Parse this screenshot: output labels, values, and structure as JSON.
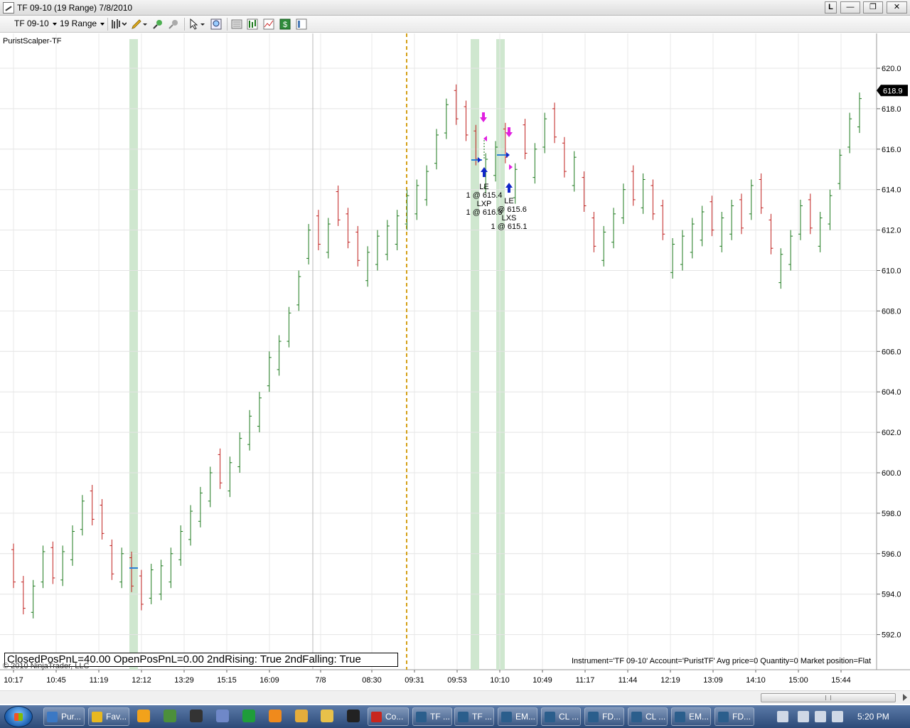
{
  "window": {
    "title": "TF 09-10 (19 Range)  7/8/2010",
    "buttons": {
      "l": "L",
      "minimize": "—",
      "restore": "❐",
      "close": "✕"
    }
  },
  "toolbar": {
    "instrument": "TF 09-10",
    "period": "19 Range",
    "icons": [
      "bar-type-icon",
      "drawing-pencil-icon",
      "zoom-in-icon",
      "zoom-out-icon",
      "cursor-icon",
      "magnifier-icon",
      "data-box-icon",
      "strategy-icon",
      "indicators-icon",
      "dollar-icon",
      "properties-icon"
    ]
  },
  "chart": {
    "indicator_name": "PuristScalper-TF",
    "status_text": "ClosedPosPnL=40.00 OpenPosPnL=0.00 2ndRising: True 2ndFalling: True",
    "copyright": "© 2010 NinjaTrader, LLC",
    "instrument_info": "Instrument='TF 09-10' Account='PuristTF' Avg price=0 Quantity=0 Market position=Flat",
    "last_price": "618.9",
    "colors": {
      "up": "#1d7a1d",
      "down": "#c0201e",
      "highlight": "#cfe7cf",
      "session_line": "#d4a017",
      "last_price_bg": "#000000"
    }
  },
  "chart_data": {
    "type": "bar",
    "title": "TF 09-10 (19 Range)",
    "y_ticks": [
      "620.0",
      "618.0",
      "616.0",
      "614.0",
      "612.0",
      "610.0",
      "608.0",
      "606.0",
      "604.0",
      "602.0",
      "600.0",
      "598.0",
      "596.0",
      "594.0",
      "592.0"
    ],
    "x_ticks": [
      "10:17",
      "10:45",
      "11:19",
      "12:12",
      "13:29",
      "15:15",
      "16:09",
      "7/8",
      "08:30",
      "09:31",
      "09:53",
      "10:10",
      "10:49",
      "11:17",
      "11:44",
      "12:19",
      "13:09",
      "14:10",
      "15:00",
      "15:44"
    ],
    "ylim": [
      591,
      621
    ],
    "bars": [
      [
        596.5,
        594.3,
        1
      ],
      [
        594.9,
        593.0,
        1
      ],
      [
        594.7,
        592.8,
        0
      ],
      [
        596.4,
        594.3,
        0
      ],
      [
        596.6,
        594.5,
        1
      ],
      [
        596.4,
        594.4,
        0
      ],
      [
        597.4,
        595.4,
        0
      ],
      [
        598.9,
        596.9,
        0
      ],
      [
        599.4,
        597.4,
        1
      ],
      [
        598.7,
        596.7,
        1
      ],
      [
        596.7,
        594.7,
        1
      ],
      [
        596.3,
        594.3,
        0
      ],
      [
        596.1,
        594.1,
        1
      ],
      [
        595.2,
        593.2,
        1
      ],
      [
        595.5,
        593.5,
        0
      ],
      [
        595.7,
        593.7,
        0
      ],
      [
        596.3,
        594.3,
        0
      ],
      [
        597.4,
        595.4,
        0
      ],
      [
        598.4,
        596.4,
        0
      ],
      [
        599.3,
        597.3,
        0
      ],
      [
        600.3,
        598.3,
        0
      ],
      [
        601.2,
        599.2,
        1
      ],
      [
        600.8,
        598.8,
        0
      ],
      [
        602.0,
        600.0,
        0
      ],
      [
        603.1,
        601.1,
        0
      ],
      [
        604.0,
        602.0,
        0
      ],
      [
        606.0,
        604.0,
        0
      ],
      [
        606.8,
        604.8,
        0
      ],
      [
        608.2,
        606.2,
        0
      ],
      [
        610.0,
        608.0,
        0
      ],
      [
        612.3,
        610.3,
        0
      ],
      [
        613.0,
        611.0,
        1
      ],
      [
        612.6,
        610.6,
        0
      ],
      [
        614.2,
        612.2,
        1
      ],
      [
        613.1,
        611.1,
        1
      ],
      [
        612.2,
        610.2,
        1
      ],
      [
        611.2,
        609.2,
        0
      ],
      [
        612.0,
        610.0,
        0
      ],
      [
        612.5,
        610.5,
        0
      ],
      [
        613.0,
        611.0,
        0
      ],
      [
        614.0,
        612.0,
        0
      ],
      [
        614.5,
        612.5,
        0
      ],
      [
        615.2,
        613.2,
        0
      ],
      [
        617.0,
        615.0,
        0
      ],
      [
        618.5,
        616.5,
        0
      ],
      [
        619.2,
        617.2,
        1
      ],
      [
        618.4,
        616.4,
        1
      ],
      [
        617.2,
        615.2,
        1
      ],
      [
        615.8,
        613.8,
        0
      ],
      [
        616.4,
        614.4,
        0
      ],
      [
        617.3,
        615.3,
        1
      ],
      [
        615.3,
        613.3,
        0
      ],
      [
        617.5,
        615.5,
        1
      ],
      [
        616.3,
        614.3,
        0
      ],
      [
        617.8,
        615.8,
        0
      ],
      [
        618.3,
        616.3,
        1
      ],
      [
        616.6,
        614.6,
        1
      ],
      [
        615.9,
        613.9,
        0
      ],
      [
        614.9,
        612.9,
        1
      ],
      [
        612.9,
        610.9,
        1
      ],
      [
        612.2,
        610.2,
        0
      ],
      [
        613.1,
        611.1,
        0
      ],
      [
        614.3,
        612.3,
        0
      ],
      [
        615.2,
        613.2,
        1
      ],
      [
        614.8,
        612.8,
        0
      ],
      [
        614.5,
        612.5,
        1
      ],
      [
        613.5,
        611.5,
        1
      ],
      [
        611.6,
        609.6,
        0
      ],
      [
        612.0,
        610.0,
        0
      ],
      [
        612.6,
        610.6,
        0
      ],
      [
        613.2,
        611.2,
        0
      ],
      [
        613.7,
        611.7,
        1
      ],
      [
        612.9,
        610.9,
        0
      ],
      [
        613.5,
        611.5,
        0
      ],
      [
        613.8,
        611.8,
        1
      ],
      [
        614.5,
        612.5,
        0
      ],
      [
        614.8,
        612.8,
        1
      ],
      [
        612.8,
        610.8,
        1
      ],
      [
        611.1,
        609.1,
        0
      ],
      [
        612.0,
        610.0,
        0
      ],
      [
        613.5,
        611.5,
        0
      ],
      [
        613.8,
        611.8,
        1
      ],
      [
        612.9,
        610.9,
        0
      ],
      [
        614.0,
        612.0,
        0
      ],
      [
        616.0,
        614.0,
        0
      ],
      [
        617.8,
        615.8,
        0
      ],
      [
        618.8,
        616.8,
        0
      ]
    ],
    "bar_format": [
      "high",
      "low",
      "down_flag"
    ],
    "trades": [
      {
        "label": "LE",
        "detail": "1 @ 615.4"
      },
      {
        "label": "LXP",
        "detail": "1 @ 616.3"
      },
      {
        "label": "LE",
        "detail": "@ 615.6"
      },
      {
        "label": "LXS",
        "detail": "1 @ 615.1"
      }
    ]
  },
  "scrollbar": {
    "grip": "|||"
  },
  "taskbar": {
    "buttons": [
      "Pur...",
      "Fav...",
      "Co...",
      "TF ...",
      "TF ...",
      "EM...",
      "CL ...",
      "FD...",
      "CL ...",
      "EM...",
      "FD..."
    ],
    "clock": "5:20 PM"
  }
}
